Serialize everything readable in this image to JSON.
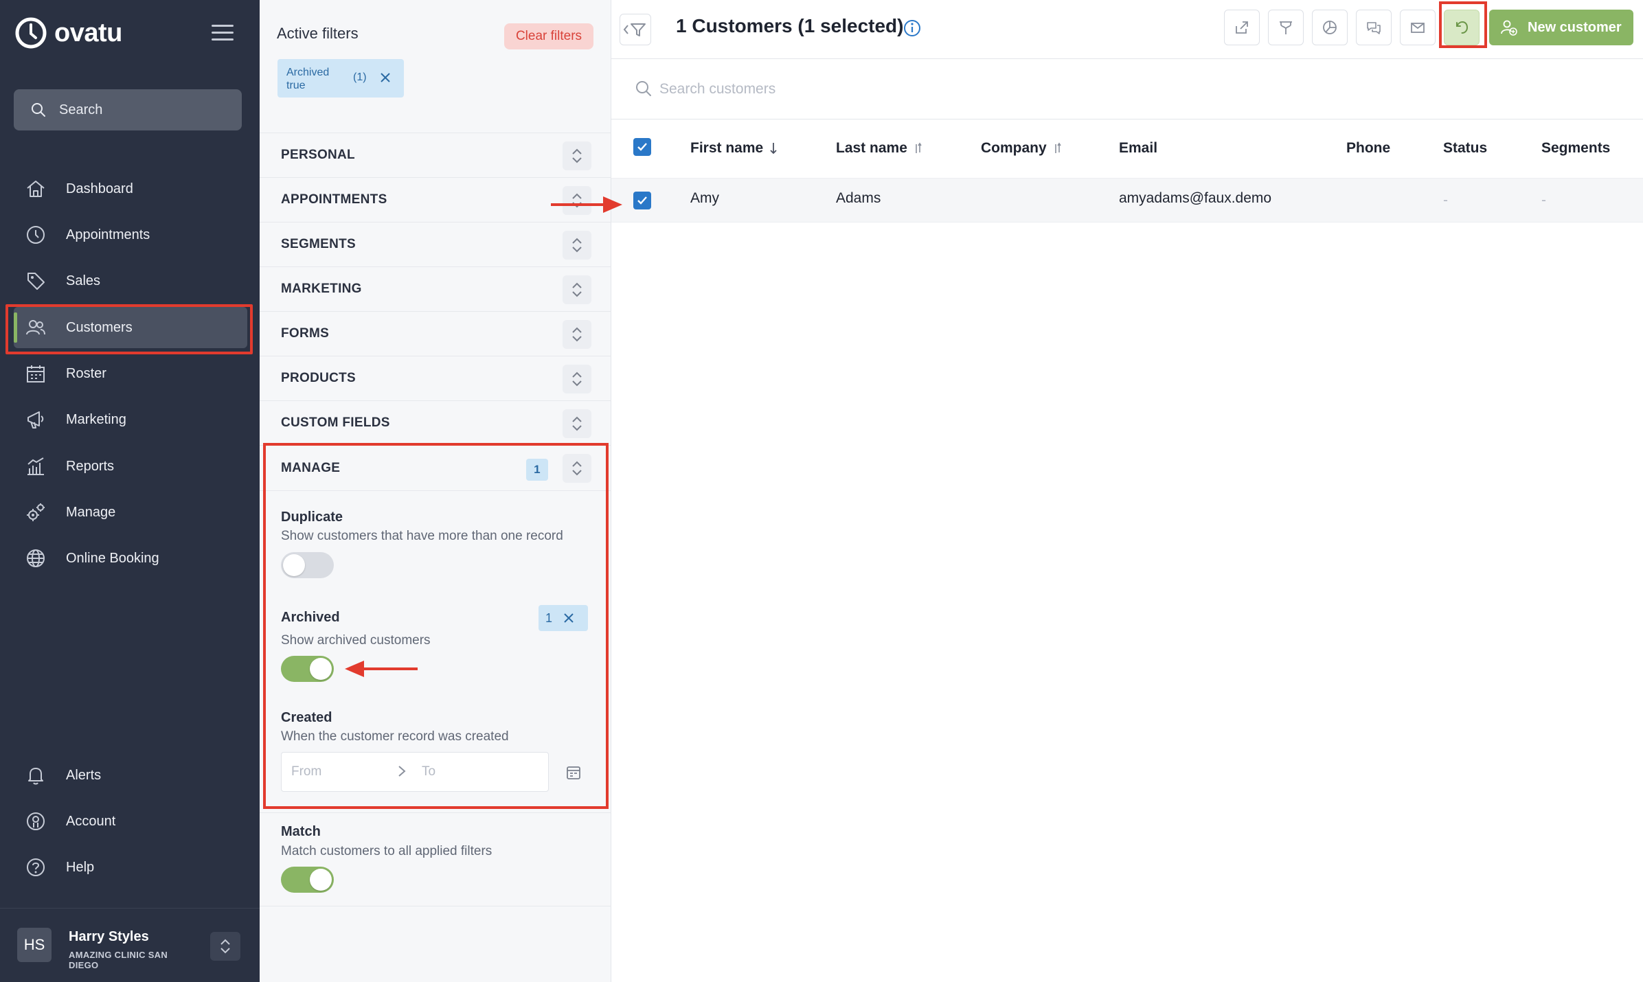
{
  "app": {
    "name": "ovatu"
  },
  "sidebar": {
    "search_label": "Search",
    "nav": [
      {
        "label": "Dashboard",
        "icon": "home-icon"
      },
      {
        "label": "Appointments",
        "icon": "clock-icon"
      },
      {
        "label": "Sales",
        "icon": "tag-icon"
      },
      {
        "label": "Customers",
        "icon": "users-icon",
        "active": true
      },
      {
        "label": "Roster",
        "icon": "calendar-icon"
      },
      {
        "label": "Marketing",
        "icon": "megaphone-icon"
      },
      {
        "label": "Reports",
        "icon": "bar-chart-icon"
      },
      {
        "label": "Manage",
        "icon": "gears-icon"
      },
      {
        "label": "Online Booking",
        "icon": "globe-icon"
      }
    ],
    "bottom_nav": [
      {
        "label": "Alerts",
        "icon": "bell-icon"
      },
      {
        "label": "Account",
        "icon": "account-icon"
      },
      {
        "label": "Help",
        "icon": "help-icon"
      }
    ],
    "user": {
      "initials": "HS",
      "name": "Harry Styles",
      "clinic": "AMAZING CLINIC SAN DIEGO"
    }
  },
  "filters": {
    "title": "Active filters",
    "clear_label": "Clear filters",
    "chip": {
      "label": "Archived true",
      "count": "(1)"
    },
    "sections": [
      "PERSONAL",
      "APPOINTMENTS",
      "SEGMENTS",
      "MARKETING",
      "FORMS",
      "PRODUCTS",
      "CUSTOM FIELDS"
    ],
    "manage": {
      "label": "MANAGE",
      "badge": "1",
      "duplicate": {
        "title": "Duplicate",
        "desc": "Show customers that have more than one record",
        "on": false
      },
      "archived": {
        "title": "Archived",
        "desc": "Show archived customers",
        "badge": "1",
        "on": true
      },
      "created": {
        "title": "Created",
        "desc": "When the customer record was created",
        "from_placeholder": "From",
        "to_placeholder": "To"
      }
    },
    "match": {
      "title": "Match",
      "desc": "Match customers to all applied filters",
      "on": true
    }
  },
  "main": {
    "title": "1 Customers (1 selected)",
    "new_customer_label": "New customer",
    "search_placeholder": "Search customers",
    "columns": [
      "First name",
      "Last name",
      "Company",
      "Email",
      "Phone",
      "Status",
      "Segments"
    ],
    "rows": [
      {
        "first_name": "Amy",
        "last_name": "Adams",
        "company": "",
        "email": "amyadams@faux.demo",
        "phone": "",
        "status": "-",
        "segments": "-",
        "selected": true
      }
    ]
  },
  "colors": {
    "sidebar_bg": "#2a3142",
    "accent_green": "#8ab564",
    "highlight_red": "#e23b2e",
    "checkbox_blue": "#2a78c8"
  }
}
